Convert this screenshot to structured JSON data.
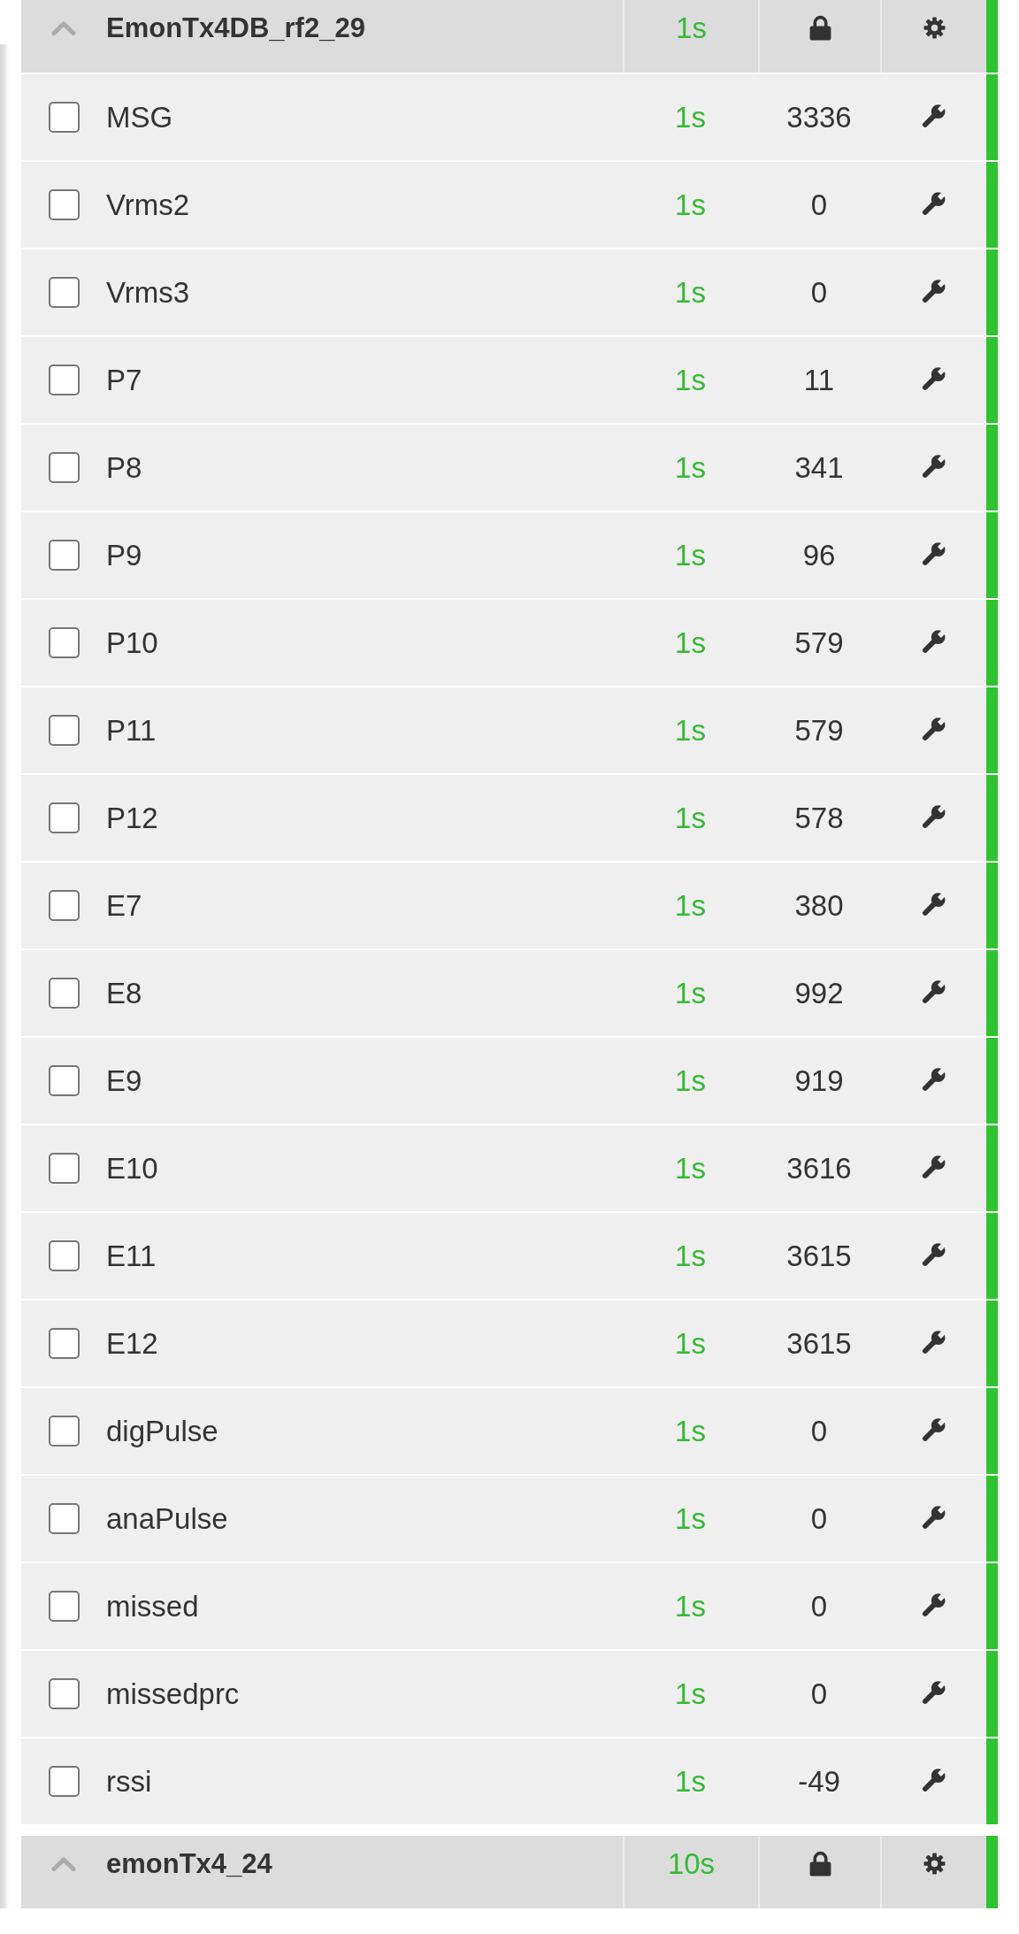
{
  "nodes": [
    {
      "name": "EmonTx4DB_rf2_29",
      "expanded": true,
      "updated": "1s",
      "inputs": [
        {
          "name": "MSG",
          "checked": false,
          "updated": "1s",
          "value": "3336"
        },
        {
          "name": "Vrms2",
          "checked": false,
          "updated": "1s",
          "value": "0"
        },
        {
          "name": "Vrms3",
          "checked": false,
          "updated": "1s",
          "value": "0"
        },
        {
          "name": "P7",
          "checked": false,
          "updated": "1s",
          "value": "11"
        },
        {
          "name": "P8",
          "checked": false,
          "updated": "1s",
          "value": "341"
        },
        {
          "name": "P9",
          "checked": false,
          "updated": "1s",
          "value": "96"
        },
        {
          "name": "P10",
          "checked": false,
          "updated": "1s",
          "value": "579"
        },
        {
          "name": "P11",
          "checked": false,
          "updated": "1s",
          "value": "579"
        },
        {
          "name": "P12",
          "checked": false,
          "updated": "1s",
          "value": "578"
        },
        {
          "name": "E7",
          "checked": false,
          "updated": "1s",
          "value": "380"
        },
        {
          "name": "E8",
          "checked": false,
          "updated": "1s",
          "value": "992"
        },
        {
          "name": "E9",
          "checked": false,
          "updated": "1s",
          "value": "919"
        },
        {
          "name": "E10",
          "checked": false,
          "updated": "1s",
          "value": "3616"
        },
        {
          "name": "E11",
          "checked": false,
          "updated": "1s",
          "value": "3615"
        },
        {
          "name": "E12",
          "checked": false,
          "updated": "1s",
          "value": "3615"
        },
        {
          "name": "digPulse",
          "checked": false,
          "updated": "1s",
          "value": "0"
        },
        {
          "name": "anaPulse",
          "checked": false,
          "updated": "1s",
          "value": "0"
        },
        {
          "name": "missed",
          "checked": false,
          "updated": "1s",
          "value": "0"
        },
        {
          "name": "missedprc",
          "checked": false,
          "updated": "1s",
          "value": "0"
        },
        {
          "name": "rssi",
          "checked": false,
          "updated": "1s",
          "value": "-49"
        }
      ]
    },
    {
      "name": "emonTx4_24",
      "expanded": true,
      "updated": "10s"
    }
  ]
}
